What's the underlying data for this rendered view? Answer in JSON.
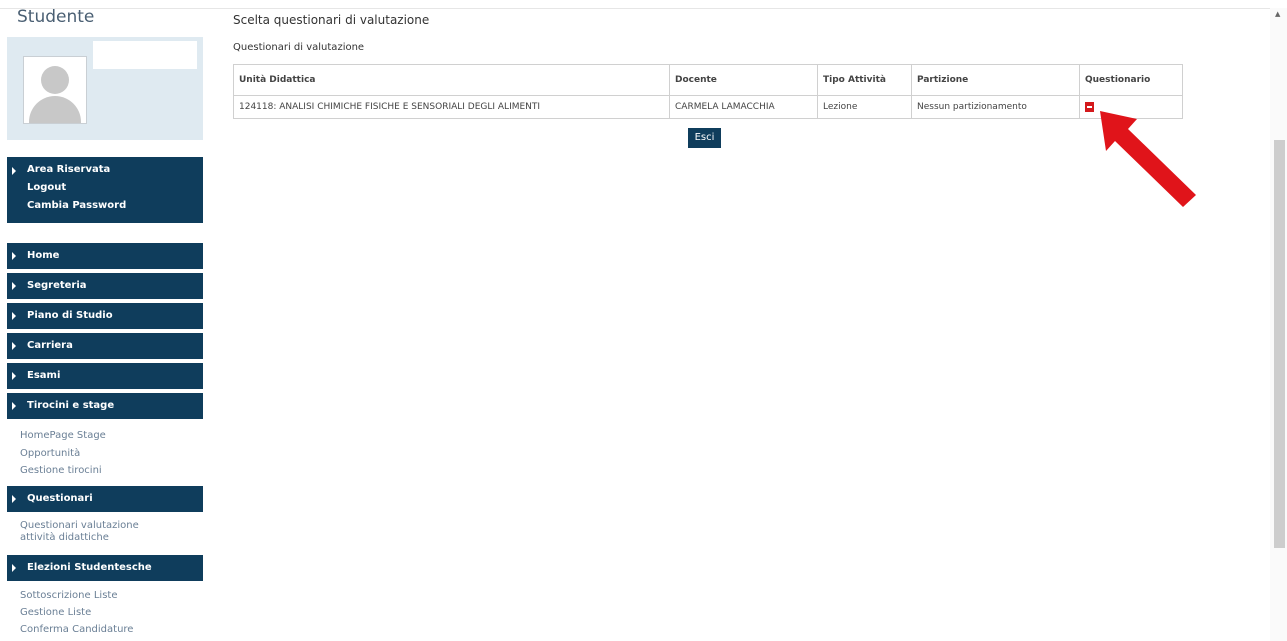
{
  "sidebar": {
    "title": "Studente",
    "area": {
      "title": "Area Riservata",
      "logout": "Logout",
      "change_password": "Cambia Password"
    },
    "menu": [
      {
        "label": "Home"
      },
      {
        "label": "Segreteria"
      },
      {
        "label": "Piano di Studio"
      },
      {
        "label": "Carriera"
      },
      {
        "label": "Esami"
      },
      {
        "label": "Tirocini e stage"
      },
      {
        "label": "Questionari"
      },
      {
        "label": "Elezioni Studentesche"
      }
    ],
    "tirocini_links": [
      "HomePage Stage",
      "Opportunità",
      "Gestione tirocini"
    ],
    "questionari_links": [
      "Questionari valutazione",
      "attività didattiche"
    ],
    "elezioni_links": [
      "Sottoscrizione Liste",
      "Gestione Liste",
      "Conferma Candidature"
    ]
  },
  "main": {
    "page_title": "Scelta questionari di valutazione",
    "section_title": "Questionari di valutazione",
    "table": {
      "headers": [
        "Unità Didattica",
        "Docente",
        "Tipo Attività",
        "Partizione",
        "Questionario"
      ],
      "rows": [
        [
          "124118: ANALISI CHIMICHE FISICHE E SENSORIALI DEGLI ALIMENTI",
          "CARMELA LAMACCHIA",
          "Lezione",
          "Nessun partizionamento"
        ]
      ]
    },
    "exit_button": "Esci"
  },
  "colors": {
    "nav_bg": "#0f3d5c",
    "pdf_icon": "#d4191c",
    "arrow": "#e0141a"
  },
  "icons": {
    "questionnaire": "pdf-icon",
    "annotation": "red-arrow-icon"
  }
}
